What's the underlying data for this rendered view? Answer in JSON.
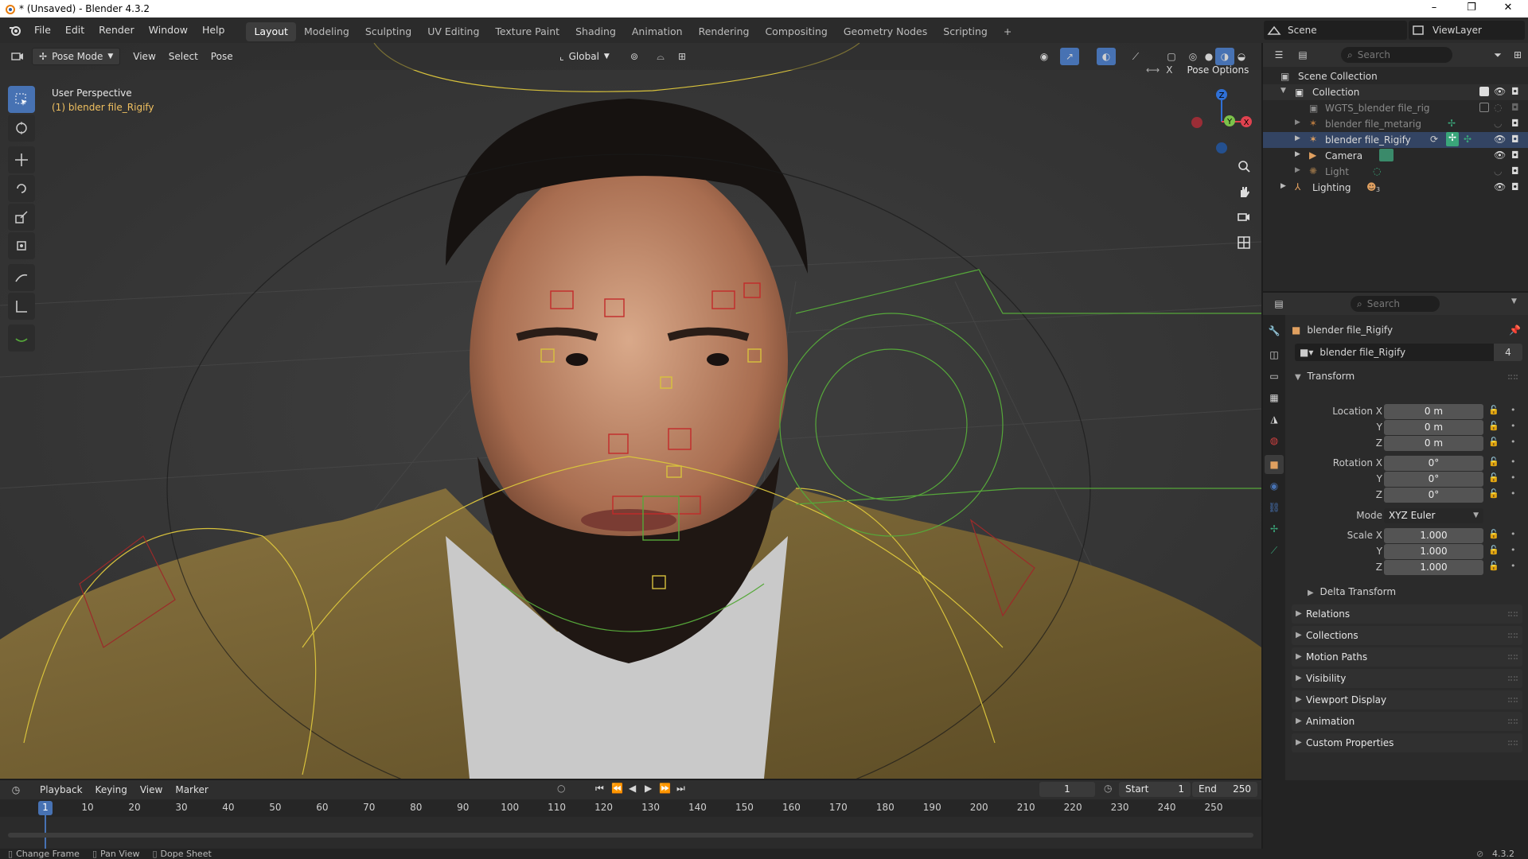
{
  "window": {
    "title": "* (Unsaved) - Blender 4.3.2",
    "minimize": "–",
    "maximize": "❐",
    "close": "✕"
  },
  "menu": {
    "items": [
      "File",
      "Edit",
      "Render",
      "Window",
      "Help"
    ],
    "workspaces": [
      "Layout",
      "Modeling",
      "Sculpting",
      "UV Editing",
      "Texture Paint",
      "Shading",
      "Animation",
      "Rendering",
      "Compositing",
      "Geometry Nodes",
      "Scripting"
    ],
    "active_workspace": "Layout",
    "add_workspace": "+",
    "scene": "Scene",
    "view_layer": "ViewLayer"
  },
  "viewport_header": {
    "mode": "Pose Mode",
    "menus": [
      "View",
      "Select",
      "Pose"
    ],
    "orientation": "Global",
    "pose_options": "Pose Options"
  },
  "viewport_overlay": {
    "perspective": "User Perspective",
    "object": "(1) blender file_Rigify"
  },
  "gizmo": {
    "z": "Z",
    "y": "Y",
    "x": "X"
  },
  "outliner": {
    "search_placeholder": "Search",
    "scene_collection": "Scene Collection",
    "rows": [
      {
        "label": "Collection",
        "dim": false
      },
      {
        "label": "WGTS_blender file_rig",
        "dim": true
      },
      {
        "label": "blender file_metarig",
        "dim": true
      },
      {
        "label": "blender file_Rigify",
        "dim": false
      },
      {
        "label": "Camera",
        "dim": false
      },
      {
        "label": "Light",
        "dim": true
      },
      {
        "label": "Lighting",
        "dim": false
      }
    ],
    "lighting_count": "3"
  },
  "properties": {
    "search_placeholder": "Search",
    "object_name": "blender file_Rigify",
    "data_name": "blender file_Rigify",
    "users": "4",
    "transform_title": "Transform",
    "location": {
      "label": "Location X",
      "y_label": "Y",
      "z_label": "Z",
      "x": "0 m",
      "y": "0 m",
      "z": "0 m"
    },
    "rotation": {
      "label": "Rotation X",
      "y_label": "Y",
      "z_label": "Z",
      "x": "0°",
      "y": "0°",
      "z": "0°"
    },
    "mode": {
      "label": "Mode",
      "value": "XYZ Euler"
    },
    "scale": {
      "label": "Scale X",
      "y_label": "Y",
      "z_label": "Z",
      "x": "1.000",
      "y": "1.000",
      "z": "1.000"
    },
    "delta": "Delta Transform",
    "panels": [
      "Relations",
      "Collections",
      "Motion Paths",
      "Visibility",
      "Viewport Display",
      "Animation",
      "Custom Properties"
    ]
  },
  "timeline": {
    "menus": [
      "Playback",
      "Keying",
      "View",
      "Marker"
    ],
    "current_frame": "1",
    "start_label": "Start",
    "start": "1",
    "end_label": "End",
    "end": "250",
    "ticks": [
      "1",
      "10",
      "20",
      "30",
      "40",
      "50",
      "60",
      "70",
      "80",
      "90",
      "100",
      "110",
      "120",
      "130",
      "140",
      "150",
      "160",
      "170",
      "180",
      "190",
      "200",
      "210",
      "220",
      "230",
      "240",
      "250"
    ]
  },
  "statusbar": {
    "items": [
      "Change Frame",
      "Pan View",
      "Dope Sheet"
    ],
    "version": "4.3.2"
  },
  "colors": {
    "accent": "#4772b3",
    "active_object": "#f0c060",
    "viewport_bg": "#3a3a3a"
  }
}
